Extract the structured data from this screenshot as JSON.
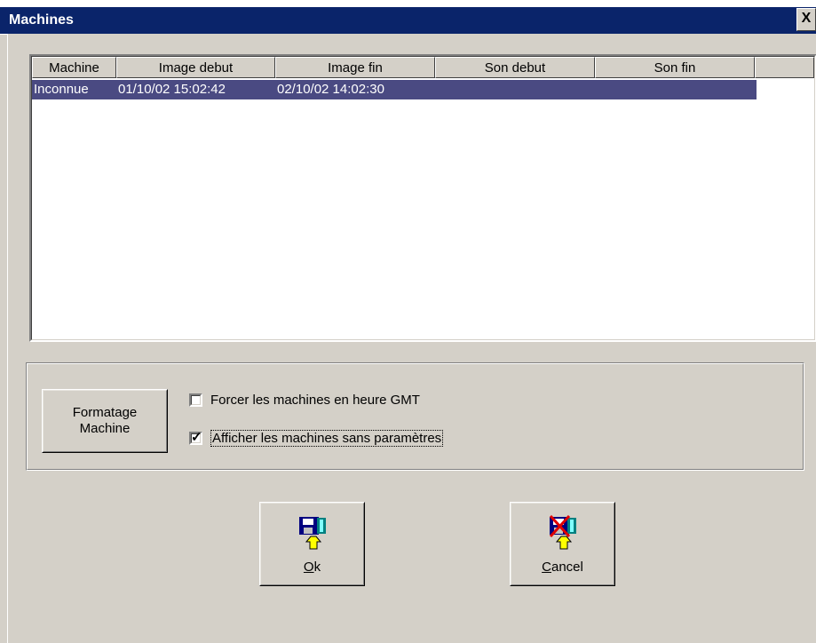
{
  "window": {
    "title": "Machines",
    "close_glyph": "X"
  },
  "table": {
    "columns": [
      "Machine",
      "Image debut",
      "Image fin",
      "Son debut",
      "Son fin"
    ],
    "rows": [
      {
        "machine": "Inconnue",
        "image_debut": "01/10/02 15:02:42",
        "image_fin": "02/10/02 14:02:30",
        "son_debut": "",
        "son_fin": ""
      }
    ],
    "selected_row_color": "#4a4a82"
  },
  "options": {
    "format_button_line1": "Formatage",
    "format_button_line2": "Machine",
    "force_gmt": {
      "label": "Forcer les machines en heure GMT",
      "checked": false
    },
    "show_no_params": {
      "label": "Afficher les machines sans paramètres",
      "checked": true
    }
  },
  "actions": {
    "ok": {
      "mnemonic": "O",
      "rest": "k",
      "icon": "save-disk-icon"
    },
    "cancel": {
      "mnemonic": "C",
      "rest": "ancel",
      "icon": "cancel-disk-icon"
    }
  },
  "colors": {
    "titlebar": "#0a246a",
    "face": "#d4d0c8"
  }
}
